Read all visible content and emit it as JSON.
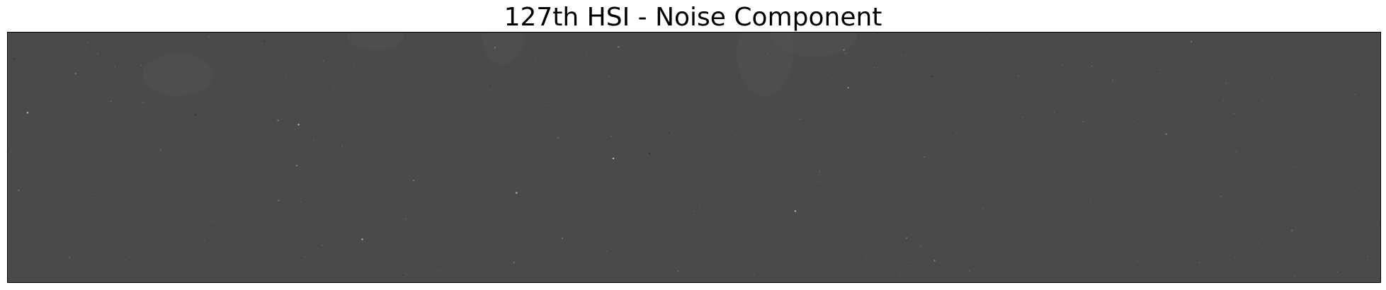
{
  "figure": {
    "title": "127th HSI - Noise Component"
  },
  "image": {
    "description_colors": {
      "background": "#ffffff",
      "noise_base": "#4a4a4a",
      "frame": "#000000",
      "speck_light": "#9a9a9a",
      "speck_dark": "#2e2e2e"
    }
  }
}
